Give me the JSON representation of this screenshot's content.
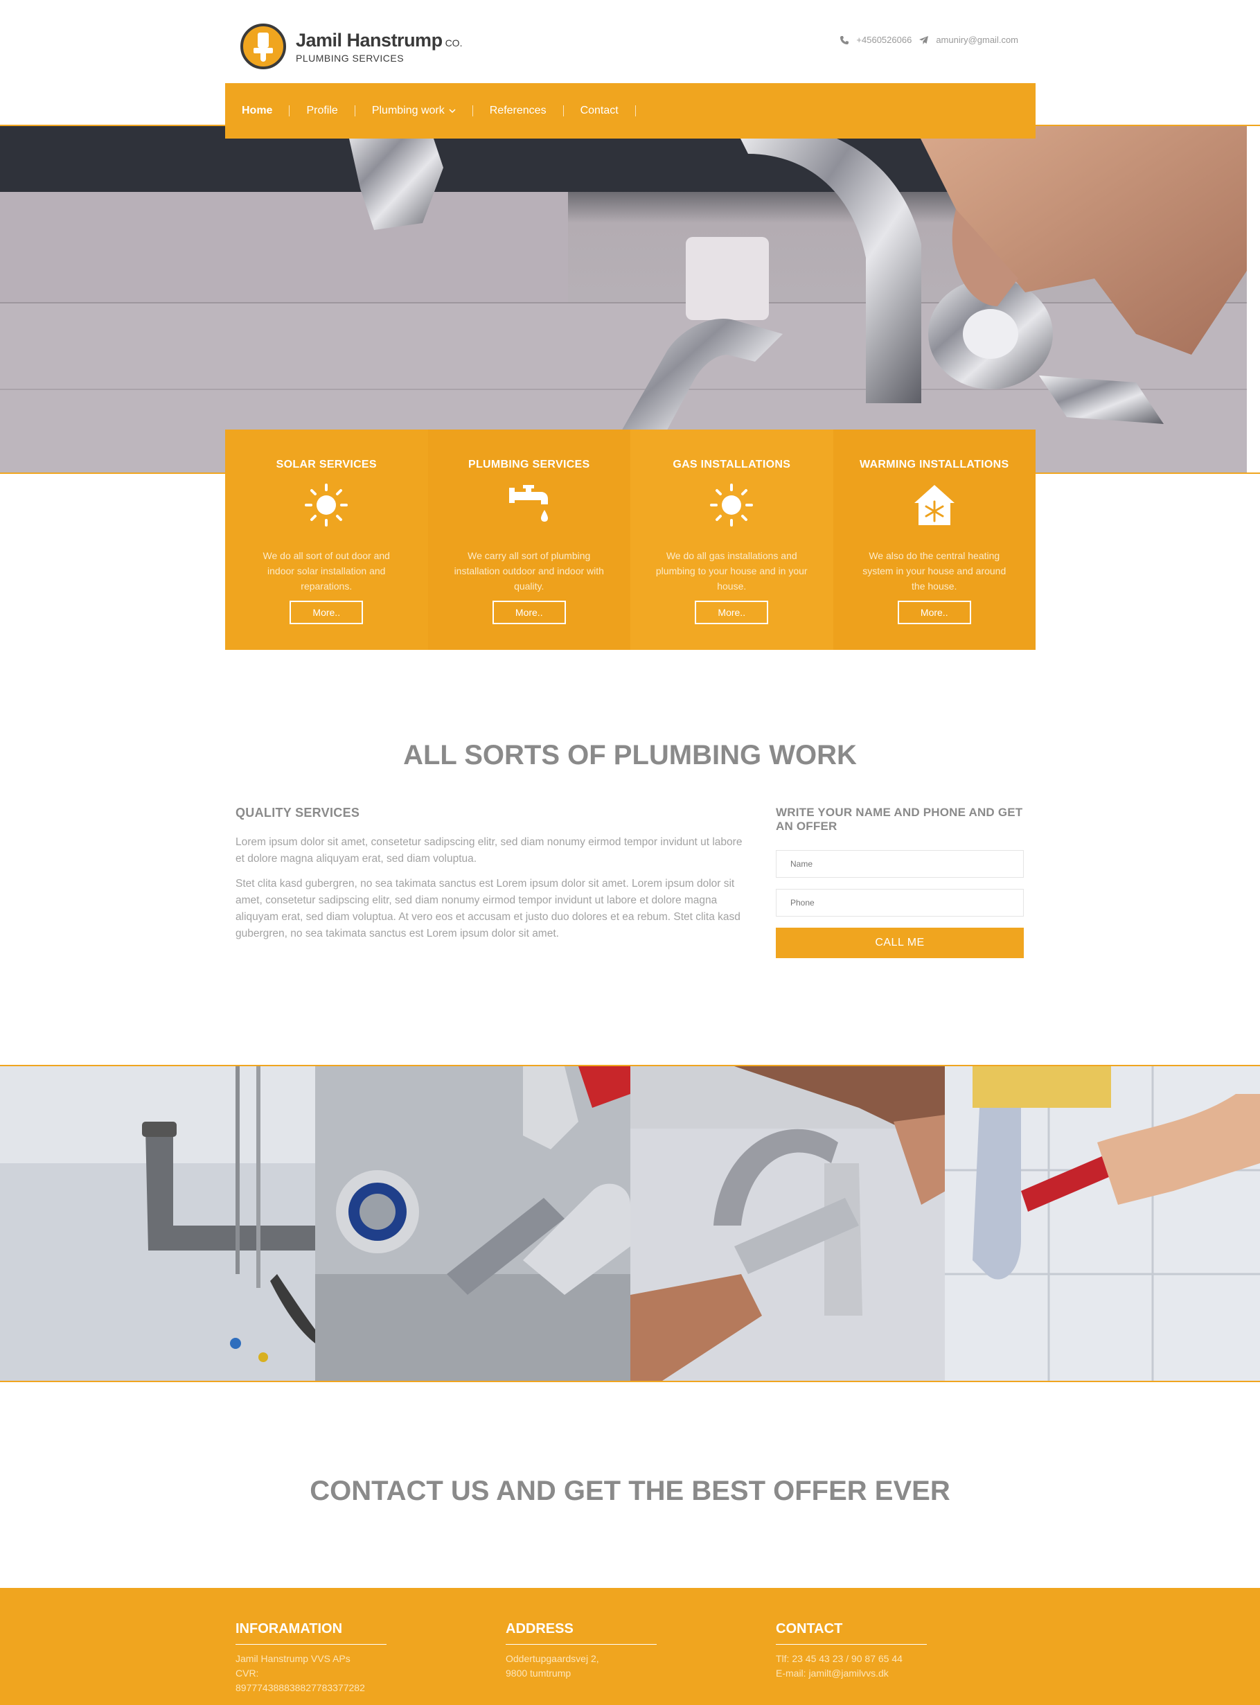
{
  "brand": {
    "name": "Jamil Hanstrump",
    "suffix": "CO.",
    "subtitle": "PLUMBING SERVICES",
    "accent_color": "#f0a51f",
    "logo_icon": "plunger-icon"
  },
  "top_contact": {
    "phone_icon": "phone-icon",
    "phone": "+4560526066",
    "email_icon": "paper-plane-icon",
    "email": "amuniry@gmail.com"
  },
  "nav": {
    "items": [
      {
        "label": "Home",
        "active": true
      },
      {
        "label": "Profile"
      },
      {
        "label": "Plumbing work",
        "has_dropdown": true,
        "dropdown_icon": "chevron-down-icon"
      },
      {
        "label": "References"
      },
      {
        "label": "Contact"
      }
    ]
  },
  "services": [
    {
      "title": "SOLAR SERVICES",
      "icon": "sun-icon",
      "text": "We do all sort of out door and indoor solar installation and reparations.",
      "button": "More.."
    },
    {
      "title": "PLUMBING SERVICES",
      "icon": "faucet-icon",
      "text": "We carry all sort of plumbing installation outdoor and indoor with quality.",
      "button": "More.."
    },
    {
      "title": "GAS INSTALLATIONS",
      "icon": "sun-icon",
      "text": "We do all gas installations and plumbing to your house and in your house.",
      "button": "More.."
    },
    {
      "title": "WARMING INSTALLATIONS",
      "icon": "house-snowflake-icon",
      "text": "We also do the central heating system in your house and around the house.",
      "button": "More.."
    }
  ],
  "main": {
    "title": "ALL SORTS OF PLUMBING WORK",
    "quality": {
      "heading": "QUALITY SERVICES",
      "p1": "Lorem ipsum dolor sit amet, consetetur sadipscing elitr, sed diam nonumy eirmod tempor invidunt ut labore et dolore magna aliquyam erat, sed diam voluptua.",
      "p2": "Stet clita kasd gubergren, no sea takimata sanctus est Lorem ipsum dolor sit amet. Lorem ipsum dolor sit amet, consetetur sadipscing elitr, sed diam nonumy eirmod tempor invidunt ut labore et dolore magna aliquyam erat, sed diam voluptua. At vero eos et accusam et justo duo dolores et ea rebum. Stet clita kasd gubergren, no sea takimata sanctus est Lorem ipsum dolor sit amet."
    },
    "offer": {
      "heading": "WRITE YOUR NAME AND PHONE AND GET AN OFFER",
      "name_placeholder": "Name",
      "phone_placeholder": "Phone",
      "button": "CALL ME"
    }
  },
  "cta": {
    "title": "CONTACT US AND GET THE BEST OFFER EVER"
  },
  "footer": {
    "info": {
      "heading": "INFORAMATION",
      "line1": "Jamil Hanstrump VVS APs",
      "line2": "CVR: 897774388838827783377282"
    },
    "address": {
      "heading": "ADDRESS",
      "line1": "Oddertupgaardsvej 2,",
      "line2": "9800 tumtrump"
    },
    "contact": {
      "heading": "CONTACT",
      "line1": "Tlf: 23 45 43 23 / 90 87 65 44",
      "line2": "E-mail: jamilt@jamilvvs.dk"
    }
  }
}
